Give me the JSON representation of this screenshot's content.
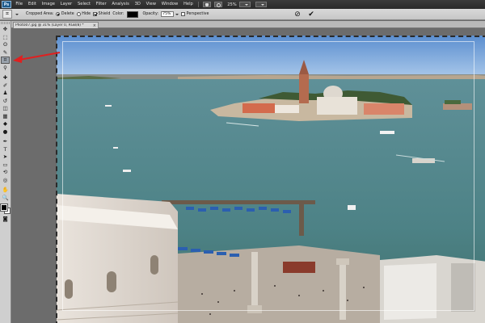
{
  "app": {
    "logo_text": "Ps"
  },
  "menu": {
    "items": [
      "File",
      "Edit",
      "Image",
      "Layer",
      "Select",
      "Filter",
      "Analysis",
      "3D",
      "View",
      "Window",
      "Help"
    ],
    "zoom_level": "25%"
  },
  "options": {
    "cropped_area_label": "Cropped Area:",
    "delete_label": "Delete",
    "hide_label": "Hide",
    "shield_label": "Shield",
    "shield_checked": true,
    "color_label": "Color:",
    "color_value": "#000000",
    "opacity_label": "Opacity:",
    "opacity_value": "75%",
    "perspective_label": "Perspective",
    "perspective_checked": false
  },
  "document": {
    "tab_title": "Photo07.jpg @ 31% (Layer 0, RGB/8) *",
    "close_glyph": "×"
  },
  "tools": [
    {
      "name": "move-tool",
      "glyph": "✥"
    },
    {
      "name": "marquee-tool",
      "glyph": "⬚"
    },
    {
      "name": "lasso-tool",
      "glyph": "ʘ"
    },
    {
      "name": "quick-select-tool",
      "glyph": "✎"
    },
    {
      "name": "crop-tool",
      "glyph": "⌗",
      "active": true
    },
    {
      "name": "eyedropper-tool",
      "glyph": "⚲"
    },
    {
      "name": "healing-tool",
      "glyph": "✚"
    },
    {
      "name": "brush-tool",
      "glyph": "✐"
    },
    {
      "name": "clone-stamp-tool",
      "glyph": "♟"
    },
    {
      "name": "history-brush-tool",
      "glyph": "↺"
    },
    {
      "name": "eraser-tool",
      "glyph": "◫"
    },
    {
      "name": "gradient-tool",
      "glyph": "▦"
    },
    {
      "name": "blur-tool",
      "glyph": "◆"
    },
    {
      "name": "dodge-tool",
      "glyph": "●"
    },
    {
      "name": "pen-tool",
      "glyph": "✒"
    },
    {
      "name": "type-tool",
      "glyph": "T"
    },
    {
      "name": "path-select-tool",
      "glyph": "➤"
    },
    {
      "name": "shape-tool",
      "glyph": "▭"
    },
    {
      "name": "3d-rotate-tool",
      "glyph": "⟲"
    },
    {
      "name": "3d-orbit-tool",
      "glyph": "◎"
    },
    {
      "name": "hand-tool",
      "glyph": "✋"
    },
    {
      "name": "zoom-tool",
      "glyph": "🔍"
    }
  ],
  "colors": {
    "annotation_arrow": "#e02020",
    "foreground": "#000000",
    "background": "#ffffff"
  }
}
